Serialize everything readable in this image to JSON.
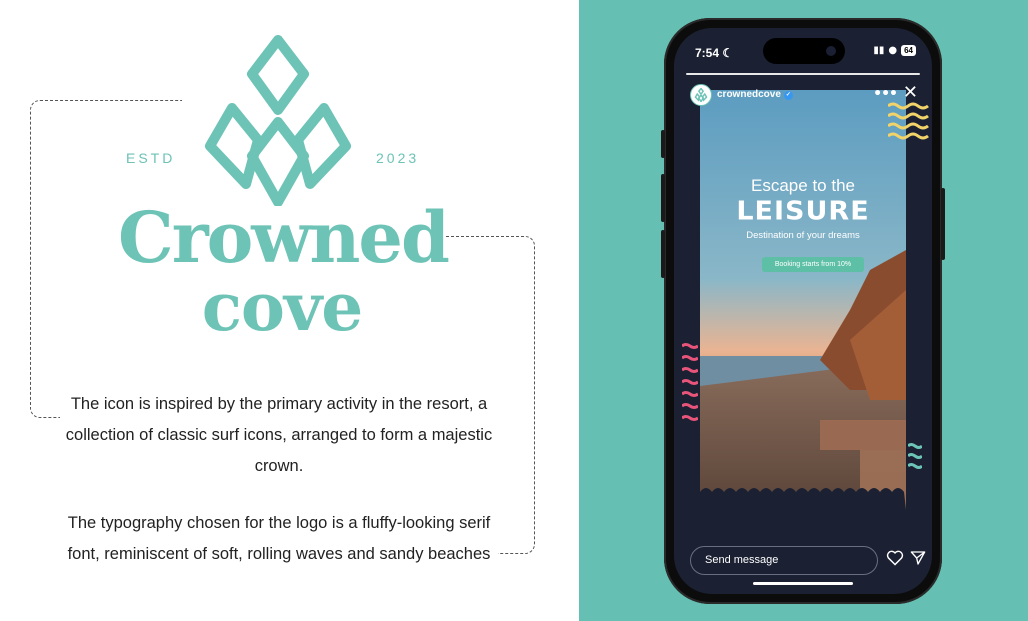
{
  "brand": {
    "estd_label": "ESTD",
    "year": "2023",
    "name_line1": "Crowned",
    "name_line2": "cove",
    "color": "#6cc3b6"
  },
  "descriptions": {
    "icon_text": "The icon is inspired by the primary activity in the resort, a collection of classic surf icons, arranged to form a majestic crown.",
    "typography_text": "The typography chosen for the logo is a fluffy-looking serif font, reminiscent of soft, rolling waves and sandy beaches"
  },
  "phone": {
    "status_time": "7:54",
    "moon_icon": "moon-icon",
    "battery": "64",
    "story": {
      "username": "crownedcove",
      "headline": "Escape to the",
      "title": "LEISURE",
      "subtitle": "Destination of your dreams",
      "pill": "Booking starts from 10%"
    },
    "message_placeholder": "Send message"
  },
  "colors": {
    "teal_bg": "#66bfb3",
    "pink_wave": "#e8547a",
    "yellow_wave": "#f1d36a"
  }
}
